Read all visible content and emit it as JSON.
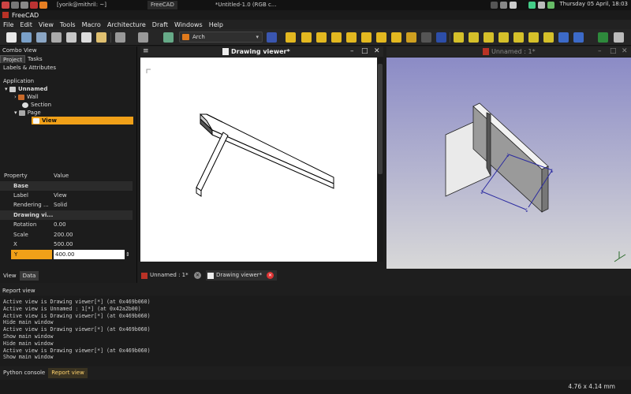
{
  "system_bar": {
    "tasks": [
      "[yorik@mithril: ~]",
      "FreeCAD",
      "*Untitled-1.0 (RGB c..."
    ],
    "clock": "Thursday 05 April, 18:03"
  },
  "app": {
    "title": "FreeCAD"
  },
  "menu": [
    "File",
    "Edit",
    "View",
    "Tools",
    "Macro",
    "Architecture",
    "Draft",
    "Windows",
    "Help"
  ],
  "toolbar": {
    "workbench": "Arch"
  },
  "combo": {
    "title": "Combo View",
    "tabs": [
      "Project",
      "Tasks"
    ],
    "labels_header": "Labels & Attributes",
    "root": "Application",
    "tree": [
      {
        "label": "Unnamed"
      },
      {
        "label": "Wall"
      },
      {
        "label": "Section"
      },
      {
        "label": "Page"
      },
      {
        "label": "View"
      }
    ],
    "prop_header": {
      "k": "Property",
      "v": "Value"
    },
    "props": [
      {
        "k": "Base",
        "v": ""
      },
      {
        "k": "Label",
        "v": "View"
      },
      {
        "k": "Rendering ...",
        "v": "Solid"
      },
      {
        "k": "Drawing vi...",
        "v": ""
      },
      {
        "k": "Rotation",
        "v": "0.00"
      },
      {
        "k": "Scale",
        "v": "200.00"
      },
      {
        "k": "X",
        "v": "500.00"
      },
      {
        "k": "Y",
        "v": "400.00"
      }
    ],
    "bottom_tabs": [
      "View",
      "Data"
    ]
  },
  "drawing_viewer": {
    "title": "Drawing viewer*"
  },
  "view3d": {
    "title": "Unnamed : 1*"
  },
  "doc_tabs": [
    "Unnamed : 1*",
    "Drawing viewer*"
  ],
  "report": {
    "title": "Report view",
    "lines": [
      "Active view is Drawing viewer[*] (at 0x469b060)",
      "Active view is Unnamed : 1[*] (at 0x42a2b00)",
      "Active view is Drawing viewer[*] (at 0x469b060)",
      "Hide main window",
      "Active view is Drawing viewer[*] (at 0x469b060)",
      "Show main window",
      "Hide main window",
      "Active view is Drawing viewer[*] (at 0x469b060)",
      "Show main window"
    ]
  },
  "bottom_tabs": [
    "Python console",
    "Report view"
  ],
  "status": {
    "coords": "4.76 x 4.14 mm"
  },
  "colors": {
    "accent": "#f0a018",
    "view3d_top": "#8b8bc6",
    "view3d_bottom": "#d8d8d8"
  }
}
